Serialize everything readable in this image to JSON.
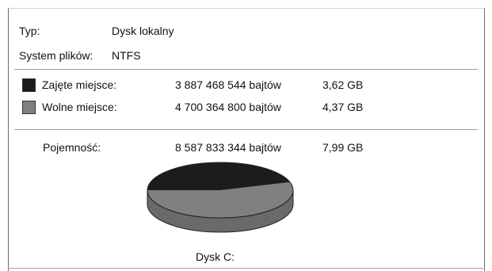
{
  "general": {
    "type_label": "Typ:",
    "type_value": "Dysk lokalny",
    "fs_label": "System plików:",
    "fs_value": "NTFS"
  },
  "usage": {
    "used": {
      "label": "Zajęte miejsce:",
      "bytes": "3 887 468 544 bajtów",
      "size": "3,62 GB",
      "color": "#1c1c1c"
    },
    "free": {
      "label": "Wolne miejsce:",
      "bytes": "4 700 364 800 bajtów",
      "size": "4,37 GB",
      "color": "#808080"
    }
  },
  "capacity": {
    "label": "Pojemność:",
    "bytes": "8 587 833 344 bajtów",
    "size": "7,99 GB"
  },
  "drive": {
    "name": "Dysk C:",
    "used_fraction": 0.4527
  }
}
